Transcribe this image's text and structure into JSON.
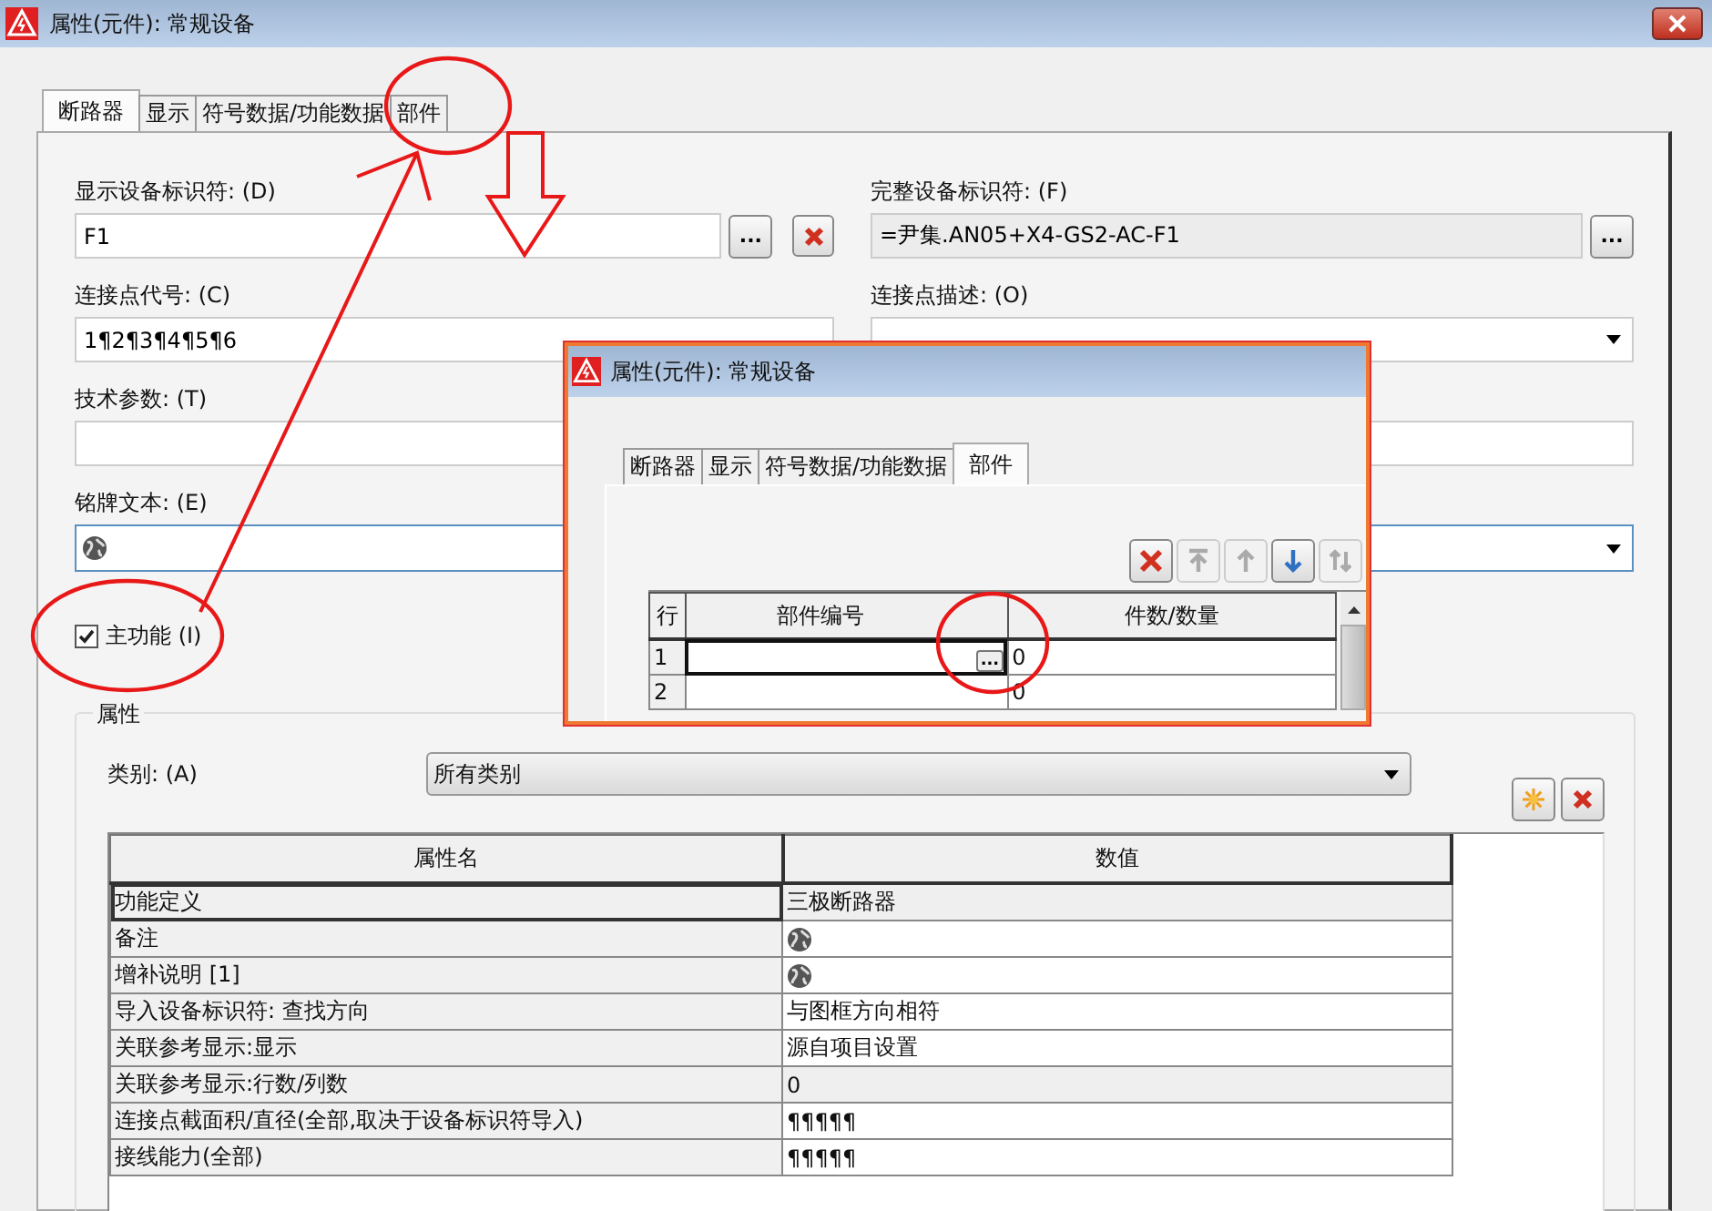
{
  "window": {
    "title": "属性(元件): 常规设备"
  },
  "tabs": [
    {
      "label": "断路器",
      "selected": true
    },
    {
      "label": "显示",
      "selected": false
    },
    {
      "label": "符号数据/功能数据",
      "selected": false
    },
    {
      "label": "部件",
      "selected": false
    }
  ],
  "display_id": {
    "label": "显示设备标识符: (D)",
    "value": "F1",
    "button": "..."
  },
  "full_id": {
    "label": "完整设备标识符: (F)",
    "value": "=尹集.AN05+X4-GS2-AC-F1",
    "button": "..."
  },
  "conn_code": {
    "label": "连接点代号: (C)",
    "value": "1¶2¶3¶4¶5¶6"
  },
  "conn_desc": {
    "label": "连接点描述: (O)"
  },
  "tech_params": {
    "label": "技术参数: (T)"
  },
  "nameplate": {
    "label": "铭牌文本: (E)"
  },
  "main_function": {
    "label": "主功能 (I)",
    "checked": true
  },
  "properties": {
    "title": "属性",
    "category_label": "类别: (A)",
    "category_value": "所有类别",
    "columns": [
      "属性名",
      "数值"
    ],
    "rows": [
      {
        "name": "功能定义",
        "kind": "text",
        "value": "三极断路器",
        "selected": true,
        "shaded": true
      },
      {
        "name": "备注",
        "kind": "globe",
        "selected": false,
        "shaded": false
      },
      {
        "name": "增补说明 [1]",
        "kind": "globe",
        "selected": false,
        "shaded": false
      },
      {
        "name": "导入设备标识符: 查找方向",
        "kind": "text",
        "value": "与图框方向相符",
        "selected": false,
        "shaded": false
      },
      {
        "name": "关联参考显示:显示",
        "kind": "text",
        "value": "源自项目设置",
        "selected": false,
        "shaded": false
      },
      {
        "name": "关联参考显示:行数/列数",
        "kind": "text",
        "value": "0",
        "selected": false,
        "shaded": true
      },
      {
        "name": "连接点截面积/直径(全部,取决于设备标识符导入)",
        "kind": "text",
        "value": "¶¶¶¶¶",
        "selected": false,
        "shaded": false
      },
      {
        "name": "接线能力(全部)",
        "kind": "text",
        "value": "¶¶¶¶¶",
        "selected": false,
        "shaded": false
      }
    ]
  },
  "inset": {
    "title": "属性(元件): 常规设备",
    "tabs": [
      {
        "label": "断路器",
        "selected": false
      },
      {
        "label": "显示",
        "selected": false
      },
      {
        "label": "符号数据/功能数据",
        "selected": false
      },
      {
        "label": "部件",
        "selected": true
      }
    ],
    "toolbar": [
      {
        "kind": "delete",
        "disabled": false
      },
      {
        "kind": "top",
        "disabled": true
      },
      {
        "kind": "up",
        "disabled": true
      },
      {
        "kind": "down",
        "disabled": false
      },
      {
        "kind": "swap",
        "disabled": true
      }
    ],
    "columns": [
      "行",
      "部件编号",
      "件数/数量"
    ],
    "cell_button": "...",
    "rows": [
      {
        "index": "1",
        "quantity": "0",
        "selected": true
      },
      {
        "index": "2",
        "quantity": "0",
        "selected": false
      }
    ]
  }
}
